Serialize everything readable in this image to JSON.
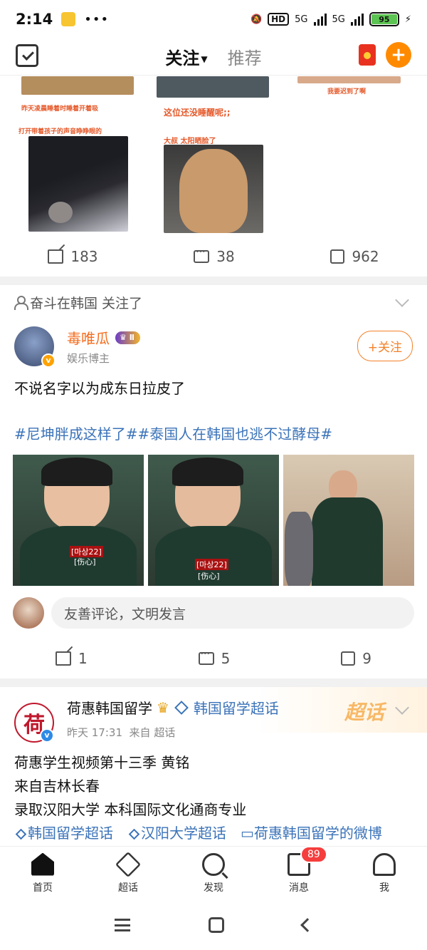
{
  "status_bar": {
    "time": "2:14",
    "dots": "•••",
    "network": "5G",
    "battery": "95"
  },
  "top_nav": {
    "tabs": [
      {
        "label": "关注"
      },
      {
        "label": "推荐"
      }
    ]
  },
  "post1": {
    "captions": [
      "昨天凌晨睡着时睡着开着吸",
      "打开带着孩子的声音睁睁眼的",
      "这位还没睡醒呢;;",
      "大叔 太阳晒脸了",
      "我要迟到了啊"
    ],
    "share": "183",
    "comments": "38",
    "likes": "962"
  },
  "post2": {
    "followed_by": "奋斗在韩国 关注了",
    "author": "毒唯瓜",
    "level": "Ⅱ",
    "subtitle": "娱乐博主",
    "follow_label": "+关注",
    "text": "不说名字以为成东日拉皮了",
    "tags": "#尼坤胖成这样了##泰国人在韩国也逃不过酵母#",
    "photo_labels": [
      "[伤心]",
      "[伤心]"
    ],
    "photo_tag": "[마상22]",
    "comment_placeholder": "友善评论，文明发言",
    "share": "1",
    "comments": "5",
    "likes": "9"
  },
  "post3": {
    "chaohua_label": "超话",
    "avatar_char": "荷",
    "author": "荷惠韩国留学",
    "topic": "韩国留学超话",
    "time": "昨天 17:31",
    "source": "来自 超话",
    "lines": [
      "荷惠学生视频第十三季 黄铭",
      "来自吉林长春",
      "录取汉阳大学 本科国际文化通商专业"
    ],
    "tags": [
      "韩国留学超话",
      "汉阳大学超话",
      "荷惠韩国留学的微博"
    ]
  },
  "bottom_nav": [
    {
      "label": "首页",
      "icon": "home-icon"
    },
    {
      "label": "超话",
      "icon": "chaohua-icon"
    },
    {
      "label": "发现",
      "icon": "discover-icon"
    },
    {
      "label": "消息",
      "icon": "message-icon",
      "badge": "89"
    },
    {
      "label": "我",
      "icon": "profile-icon"
    }
  ]
}
